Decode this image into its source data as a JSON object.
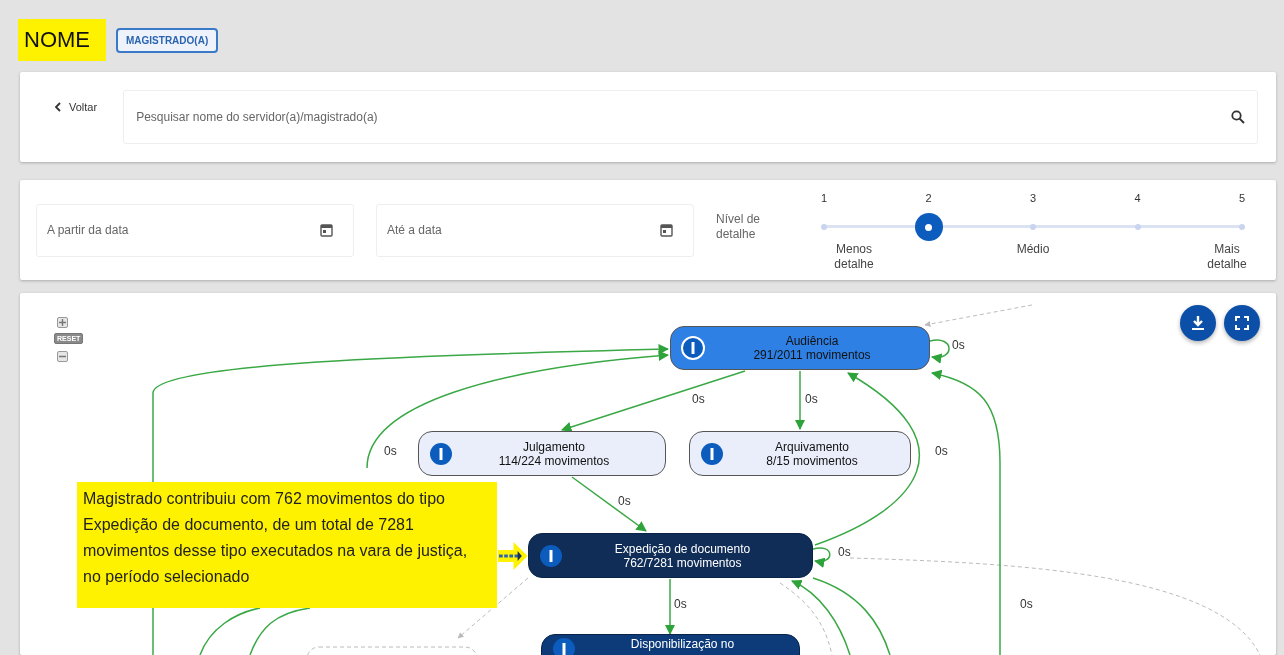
{
  "header": {
    "name": "NOME",
    "role_badge": "MAGISTRADO(A)"
  },
  "search": {
    "back_label": "Voltar",
    "placeholder": "Pesquisar nome do servidor(a)/magistrado(a)"
  },
  "filters": {
    "date_from": {
      "placeholder": "A partir da data"
    },
    "date_to": {
      "placeholder": "Até a data"
    },
    "detail_label": "Nível de detalhe",
    "slider": {
      "level": 0.25,
      "ticks": [
        {
          "label": "1",
          "caption": "Menos detalhe"
        },
        {
          "label": "2"
        },
        {
          "label": "3",
          "caption": "Médio"
        },
        {
          "label": "4"
        },
        {
          "label": "5",
          "caption": "Mais detalhe"
        }
      ]
    }
  },
  "graph": {
    "zoom_controls": {
      "reset_label": "RESET"
    },
    "nodes": [
      {
        "title": "Audiência",
        "count": "291/2011 movimentos",
        "color": "#2f80e4"
      },
      {
        "title": "Julgamento",
        "count": "114/224 movimentos",
        "color": "#e9eefa"
      },
      {
        "title": "Arquivamento",
        "count": "8/15 movimentos",
        "color": "#e9eefa"
      },
      {
        "title": "Expedição de documento",
        "count": "762/7281 movimentos",
        "color": "#0f2d57"
      },
      {
        "title": "Disponibilização no",
        "color": "#0d3b7a"
      }
    ],
    "edge_labels": [
      "0s",
      "0s",
      "0s",
      "0s",
      "0s",
      "0s",
      "0s",
      "0s",
      "0s"
    ],
    "annotation": "Magistrado contribuiu com 762 movimentos do tipo Expedição de documento, de um total de 7281 movimentos desse tipo executados na vara de justiça, no período selecionado"
  }
}
